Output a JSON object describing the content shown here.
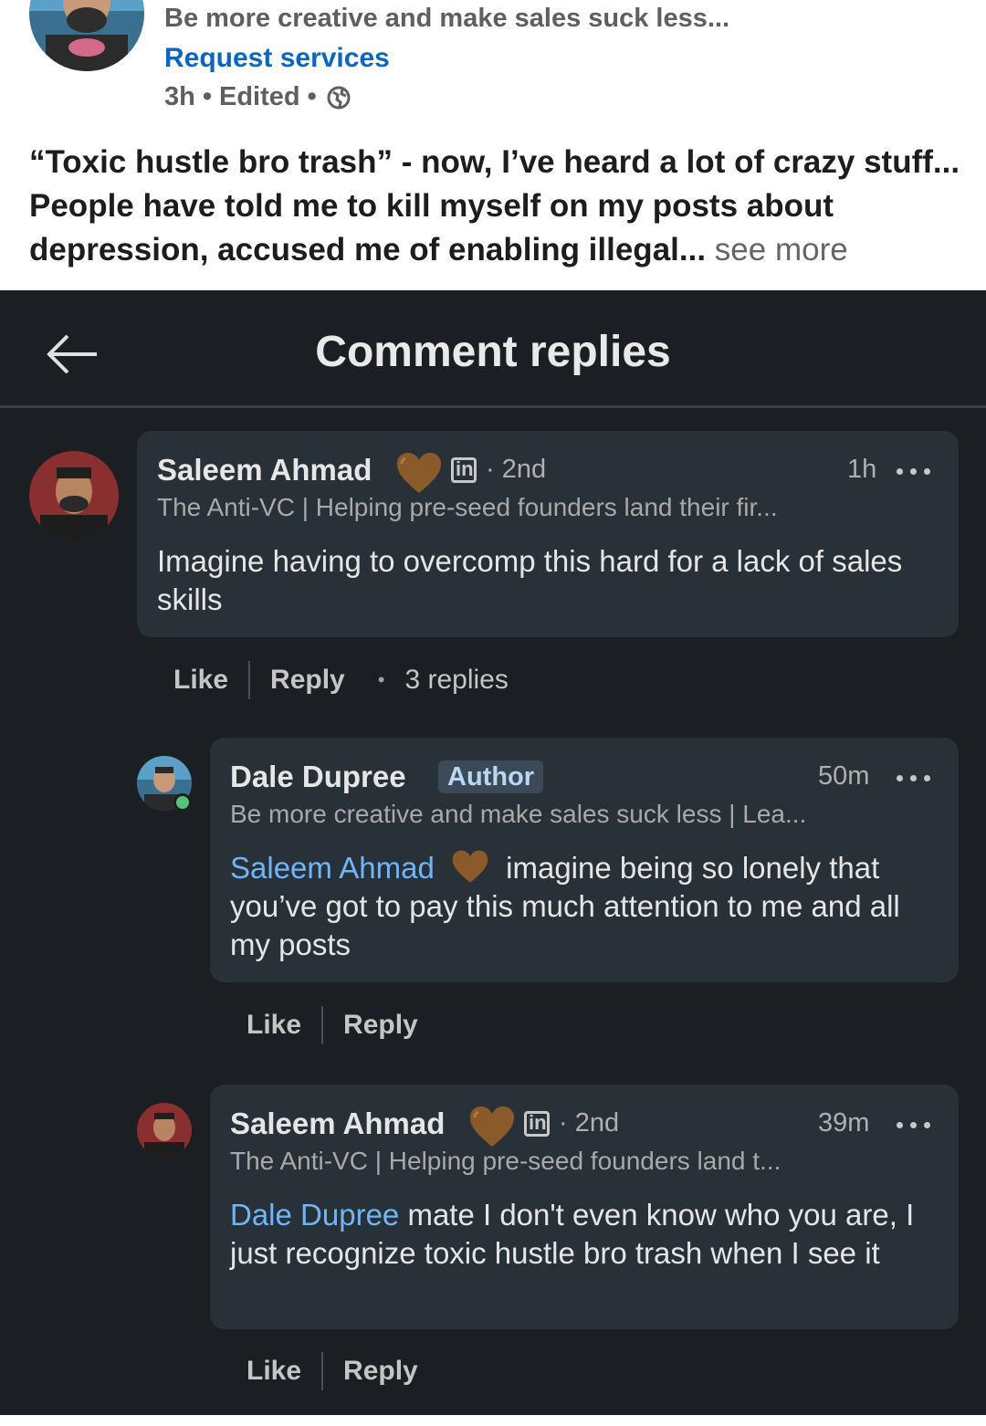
{
  "post": {
    "headline": "Be more creative and make sales suck less...",
    "request_services": "Request services",
    "time": "3h",
    "edited": "Edited",
    "separator": "•",
    "body": "“Toxic hustle bro trash” - now, I’ve heard a lot of crazy stuff... People have told me to kill myself on my posts about depression, accused me of enabling illegal...",
    "see_more": "see more"
  },
  "panel": {
    "title": "Comment replies"
  },
  "comments": [
    {
      "name": "Saleem Ahmad",
      "degree": "· 2nd",
      "time": "1h",
      "headline": "The Anti-VC | Helping pre-seed founders land their fir...",
      "text": "Imagine having to overcomp this hard for a lack of sales skills",
      "like": "Like",
      "reply": "Reply",
      "replies": "3 replies"
    },
    {
      "name": "Dale Dupree",
      "badge": "Author",
      "time": "50m",
      "headline": "Be more creative and make sales suck less | Lea...",
      "mention": "Saleem Ahmad",
      "text": "imagine being so lonely that you’ve got to pay this much attention to me and all my posts",
      "like": "Like",
      "reply": "Reply"
    },
    {
      "name": "Saleem Ahmad",
      "degree": "· 2nd",
      "time": "39m",
      "headline": "The Anti-VC | Helping pre-seed founders land t...",
      "mention": "Dale Dupree",
      "text": "mate I don't even know who you are, I just recognize toxic hustle bro trash when I see it",
      "like": "Like",
      "reply": "Reply"
    }
  ],
  "colors": {
    "panel_bg": "#1b1f23",
    "bubble_bg": "#293138",
    "link_blue": "#0a66c2",
    "mention_blue": "#70b5f9",
    "heart_brown": "#8b5a2b"
  }
}
